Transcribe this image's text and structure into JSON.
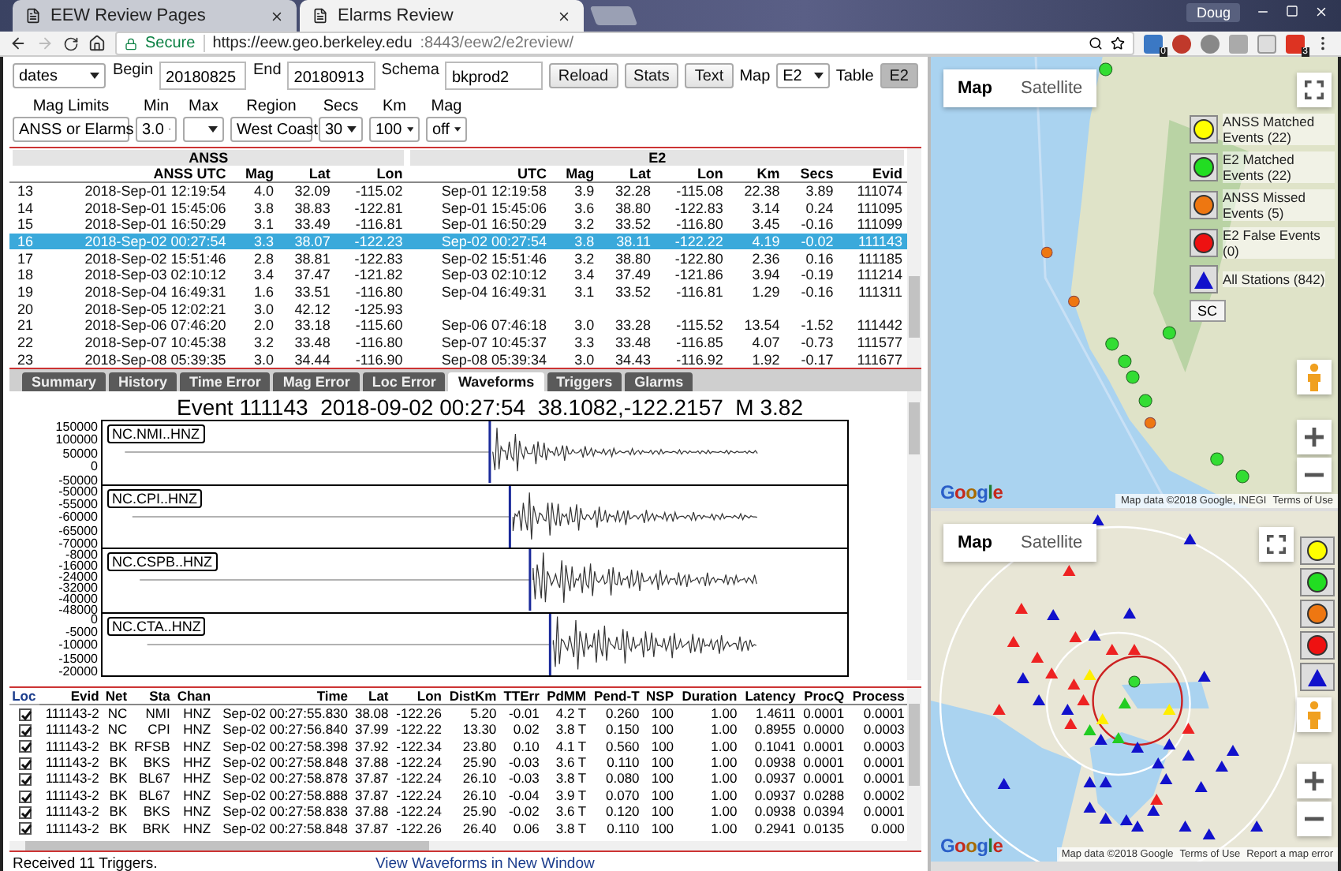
{
  "browser": {
    "tabs": [
      {
        "title": "EEW Review Pages",
        "selected": false
      },
      {
        "title": "Elarms Review",
        "selected": true
      }
    ],
    "profile": "Doug",
    "secure": "Secure",
    "url_host": "https://eew.geo.berkeley.edu",
    "url_path": ":8443/eew2/e2review/",
    "extension_badges": [
      "0",
      "3"
    ]
  },
  "controls": {
    "mode": "dates",
    "begin_label": "Begin",
    "begin": "20180825",
    "end_label": "End",
    "end": "20180913",
    "schema_label": "Schema",
    "schema": "bkprod2",
    "buttons": [
      "Reload",
      "Stats",
      "Text"
    ],
    "map_label": "Map",
    "map": "E2",
    "table_label": "Table",
    "table_button": {
      "label": "E2",
      "selected": true
    }
  },
  "filters": [
    {
      "label": "Mag Limits",
      "value": "ANSS or Elarms"
    },
    {
      "label": "Min",
      "value": "3.0"
    },
    {
      "label": "Max"
    },
    {
      "label": "Region",
      "value": "West Coast"
    },
    {
      "label": "Secs",
      "value": "30"
    },
    {
      "label": "Km",
      "value": "100"
    },
    {
      "label": "Mag",
      "value": "off"
    }
  ],
  "events": {
    "groups": [
      "ANSS",
      "E2"
    ],
    "columns": [
      "ANSS UTC",
      "Mag",
      "Lat",
      "Lon",
      "UTC",
      "Mag",
      "Lat",
      "Lon",
      "Km",
      "Secs",
      "Evid"
    ],
    "rows": [
      {
        "n": "13",
        "selected": false,
        "cells": [
          "2018-Sep-01 12:19:54",
          "4.0",
          "32.09",
          "-115.02",
          "Sep-01 12:19:58",
          "3.9",
          "32.28",
          "-115.08",
          "22.38",
          "3.89",
          "111074"
        ]
      },
      {
        "n": "14",
        "selected": false,
        "cells": [
          "2018-Sep-01 15:45:06",
          "3.8",
          "38.83",
          "-122.81",
          "Sep-01 15:45:06",
          "3.6",
          "38.80",
          "-122.83",
          "3.14",
          "0.24",
          "111095"
        ]
      },
      {
        "n": "15",
        "selected": false,
        "cells": [
          "2018-Sep-01 16:50:29",
          "3.1",
          "33.49",
          "-116.81",
          "Sep-01 16:50:29",
          "3.2",
          "33.52",
          "-116.80",
          "3.45",
          "-0.16",
          "111099"
        ]
      },
      {
        "n": "16",
        "selected": true,
        "cells": [
          "2018-Sep-02 00:27:54",
          "3.3",
          "38.07",
          "-122.23",
          "Sep-02 00:27:54",
          "3.8",
          "38.11",
          "-122.22",
          "4.19",
          "-0.02",
          "111143"
        ]
      },
      {
        "n": "17",
        "selected": false,
        "cells": [
          "2018-Sep-02 15:51:46",
          "2.8",
          "38.81",
          "-122.83",
          "Sep-02 15:51:46",
          "3.2",
          "38.80",
          "-122.80",
          "2.36",
          "0.16",
          "111185"
        ]
      },
      {
        "n": "18",
        "selected": false,
        "cells": [
          "2018-Sep-03 02:10:12",
          "3.4",
          "37.47",
          "-121.82",
          "Sep-03 02:10:12",
          "3.4",
          "37.49",
          "-121.86",
          "3.94",
          "-0.19",
          "111214"
        ]
      },
      {
        "n": "19",
        "selected": false,
        "cells": [
          "2018-Sep-04 16:49:31",
          "1.6",
          "33.51",
          "-116.80",
          "Sep-04 16:49:31",
          "3.1",
          "33.52",
          "-116.81",
          "1.29",
          "-0.16",
          "111311"
        ]
      },
      {
        "n": "20",
        "selected": false,
        "cells": [
          "2018-Sep-05 12:02:21",
          "3.0",
          "42.12",
          "-125.93"
        ]
      },
      {
        "n": "21",
        "selected": false,
        "cells": [
          "2018-Sep-06 07:46:20",
          "2.0",
          "33.18",
          "-115.60",
          "Sep-06 07:46:18",
          "3.0",
          "33.28",
          "-115.52",
          "13.54",
          "-1.52",
          "111442"
        ]
      },
      {
        "n": "22",
        "selected": false,
        "cells": [
          "2018-Sep-07 10:45:38",
          "3.2",
          "33.48",
          "-116.80",
          "Sep-07 10:45:37",
          "3.3",
          "33.48",
          "-116.85",
          "4.07",
          "-0.73",
          "111577"
        ]
      },
      {
        "n": "23",
        "selected": false,
        "cells": [
          "2018-Sep-08 05:39:35",
          "3.0",
          "34.44",
          "-116.90",
          "Sep-08 05:39:34",
          "3.0",
          "34.43",
          "-116.92",
          "1.92",
          "-0.17",
          "111677"
        ]
      }
    ]
  },
  "tabs": [
    {
      "label": "Summary",
      "selected": false
    },
    {
      "label": "History",
      "selected": false
    },
    {
      "label": "Time Error",
      "selected": false
    },
    {
      "label": "Mag Error",
      "selected": false
    },
    {
      "label": "Loc Error",
      "selected": false
    },
    {
      "label": "Waveforms",
      "selected": true
    },
    {
      "label": "Triggers",
      "selected": false
    },
    {
      "label": "Glarms",
      "selected": false
    }
  ],
  "waveforms": {
    "title": "Event 111143  2018-09-02 00:27:54  38.1082,-122.2157  M 3.82",
    "panels": [
      {
        "station": "NC.NMI..HNZ",
        "ticks": [
          "150000",
          "100000",
          "50000",
          "0",
          "-50000"
        ]
      },
      {
        "station": "NC.CPI..HNZ",
        "ticks": [
          "-50000",
          "-55000",
          "-60000",
          "-65000",
          "-70000"
        ]
      },
      {
        "station": "NC.CSPB..HNZ",
        "ticks": [
          "-8000",
          "-16000",
          "-24000",
          "-32000",
          "-40000",
          "-48000"
        ]
      },
      {
        "station": "NC.CTA..HNZ",
        "ticks": [
          "0",
          "-5000",
          "-10000",
          "-15000",
          "-20000"
        ]
      }
    ]
  },
  "triggers": {
    "check_column": "Loc",
    "columns": [
      "Evid",
      "Net",
      "Sta",
      "Chan",
      "Time",
      "Lat",
      "Lon",
      "DistKm",
      "TTErr",
      "PdMM",
      "Pend-T",
      "NSP",
      "Duration",
      "Latency",
      "ProcQ",
      "Process"
    ],
    "rows": [
      {
        "checked": true,
        "cells": [
          "111143-2",
          "NC",
          "NMI",
          "HNZ",
          "Sep-02 00:27:55.830",
          "38.08",
          "-122.26",
          "5.20",
          "-0.01",
          "4.2 T",
          "0.260",
          "100",
          "1.00",
          "1.4611",
          "0.0001",
          "0.0001"
        ]
      },
      {
        "checked": true,
        "cells": [
          "111143-2",
          "NC",
          "CPI",
          "HNZ",
          "Sep-02 00:27:56.840",
          "37.99",
          "-122.22",
          "13.30",
          "0.02",
          "3.8 T",
          "0.150",
          "100",
          "1.00",
          "0.8955",
          "0.0000",
          "0.0003"
        ]
      },
      {
        "checked": true,
        "cells": [
          "111143-2",
          "BK",
          "RFSB",
          "HNZ",
          "Sep-02 00:27:58.398",
          "37.92",
          "-122.34",
          "23.80",
          "0.10",
          "4.1 T",
          "0.560",
          "100",
          "1.00",
          "0.1041",
          "0.0001",
          "0.0003"
        ]
      },
      {
        "checked": true,
        "cells": [
          "111143-2",
          "BK",
          "BKS",
          "HHZ",
          "Sep-02 00:27:58.848",
          "37.88",
          "-122.24",
          "25.90",
          "-0.03",
          "3.6 T",
          "0.110",
          "100",
          "1.00",
          "0.0938",
          "0.0001",
          "0.0001"
        ]
      },
      {
        "checked": true,
        "cells": [
          "111143-2",
          "BK",
          "BL67",
          "HHZ",
          "Sep-02 00:27:58.878",
          "37.87",
          "-122.24",
          "26.10",
          "-0.03",
          "3.8 T",
          "0.080",
          "100",
          "1.00",
          "0.0937",
          "0.0001",
          "0.0001"
        ]
      },
      {
        "checked": true,
        "cells": [
          "111143-2",
          "BK",
          "BL67",
          "HNZ",
          "Sep-02 00:27:58.888",
          "37.87",
          "-122.24",
          "26.10",
          "-0.04",
          "3.9 T",
          "0.070",
          "100",
          "1.00",
          "0.0937",
          "0.0288",
          "0.0002"
        ]
      },
      {
        "checked": true,
        "cells": [
          "111143-2",
          "BK",
          "BKS",
          "HNZ",
          "Sep-02 00:27:58.838",
          "37.88",
          "-122.24",
          "25.90",
          "-0.02",
          "3.6 T",
          "0.120",
          "100",
          "1.00",
          "0.0938",
          "0.0394",
          "0.0001"
        ]
      },
      {
        "checked": true,
        "cells": [
          "111143-2",
          "BK",
          "BRK",
          "HNZ",
          "Sep-02 00:27:58.848",
          "37.87",
          "-122.26",
          "26.40",
          "0.06",
          "3.8 T",
          "0.110",
          "100",
          "1.00",
          "0.2941",
          "0.0135",
          "0.000"
        ]
      }
    ]
  },
  "status": "Received 11 Triggers.",
  "waveform_link": "View Waveforms in New Window",
  "overview_map": {
    "map_types": [
      {
        "label": "Map",
        "selected": true
      },
      {
        "label": "Satellite",
        "selected": false
      }
    ],
    "legend": [
      {
        "kind": "circle",
        "color": "#ffff00",
        "label": "ANSS Matched Events (22)"
      },
      {
        "kind": "circle",
        "color": "#22dd22",
        "label": "E2 Matched Events (22)"
      },
      {
        "kind": "circle",
        "color": "#ee7711",
        "label": "ANSS Missed Events (5)"
      },
      {
        "kind": "circle",
        "color": "#ee1111",
        "label": "E2 False Events (0)"
      },
      {
        "kind": "triangle",
        "color": "#1111cc",
        "label": "All Stations (842)"
      }
    ],
    "region_button": "SC",
    "logo": "Google",
    "attribution": "Map data ©2018 Google, INEGI",
    "terms": "Terms of Use"
  },
  "detail_map": {
    "map_types": [
      {
        "label": "Map",
        "selected": true
      },
      {
        "label": "Satellite",
        "selected": false
      }
    ],
    "legend": [
      {
        "kind": "circle",
        "color": "#ffff00"
      },
      {
        "kind": "circle",
        "color": "#22dd22"
      },
      {
        "kind": "circle",
        "color": "#ee7711"
      },
      {
        "kind": "circle",
        "color": "#ee1111"
      },
      {
        "kind": "triangle",
        "color": "#1111cc"
      }
    ],
    "logo": "Google",
    "attribution": "Map data ©2018 Google",
    "terms": "Terms of Use",
    "report": "Report a map error"
  }
}
